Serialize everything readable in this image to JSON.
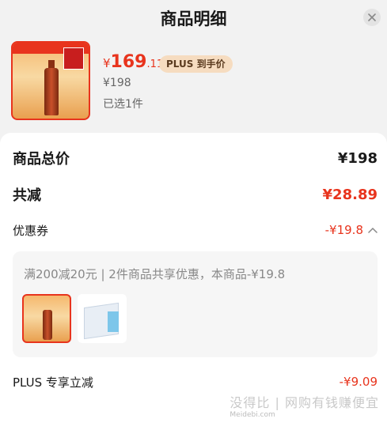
{
  "header": {
    "title": "商品明细"
  },
  "product": {
    "price_symbol": "¥",
    "price_integer": "169",
    "price_decimal": ".11",
    "plus_badge": "PLUS 到手价",
    "original_price": "¥198",
    "selected_count": "已选1件",
    "image_icon": "liquor-bottle-image"
  },
  "summary": {
    "total_label": "商品总价",
    "total_value": "¥198",
    "discount_label": "共减",
    "discount_value": "¥28.89",
    "coupon_label": "优惠券",
    "coupon_value": "-¥19.8",
    "coupon_text": "满200减20元 | 2件商品共享优惠，本商品-¥19.8",
    "plus_label": "PLUS 专享立减",
    "plus_value": "-¥9.09"
  },
  "watermark": {
    "main": "没得比 | 网购有钱赚便宜",
    "sub": "Meidebi.com"
  },
  "colors": {
    "accent": "#e8341d",
    "badge_bg": "#f6dcc0",
    "panel_bg": "#ffffff",
    "page_bg": "#f2f2f2"
  }
}
